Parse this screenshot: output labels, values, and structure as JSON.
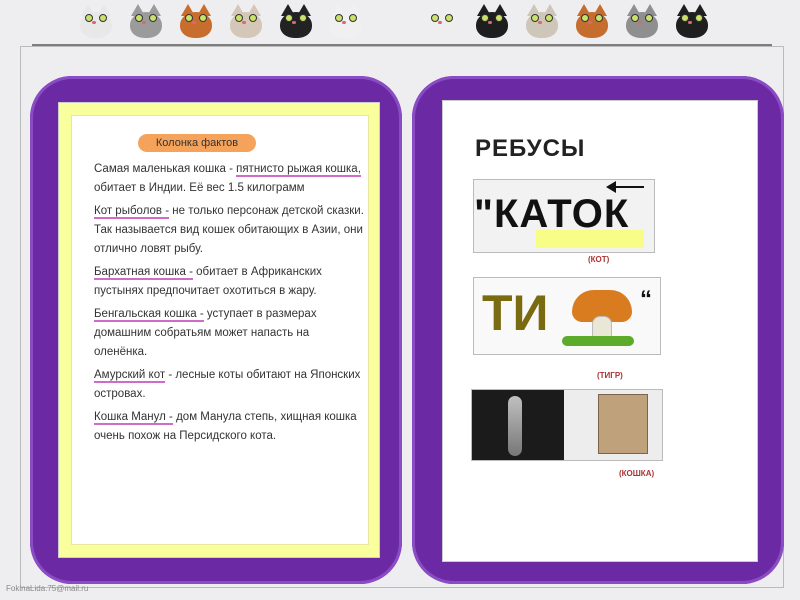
{
  "left_panel": {
    "title": "Колонка фактов",
    "facts": [
      {
        "lead": "",
        "hl": "пятнисто рыжая кошка,",
        "rest_before": "Самая маленькая кошка - ",
        "rest": " обитает в Индии. Её вес 1.5 килограмм"
      },
      {
        "hl": "Кот рыболов -",
        "rest": " не только персонаж детской сказки. Так называется вид кошек обитающих в Азии, они отлично ловят рыбу."
      },
      {
        "hl": "Бархатная кошка -",
        "rest": " обитает в Африканских пустынях предпочитает охотиться в жару."
      },
      {
        "hl": "Бенгальская кошка -",
        "rest": " уступает в размерах домашним собратьям может напасть на оленёнка."
      },
      {
        "hl": "Амурский кот",
        "rest": " - лесные коты обитают на Японских островах."
      },
      {
        "hl": "Кошка Манул -",
        "rest": " дом Манула степь, хищная кошка очень похож на Персидского кота."
      }
    ]
  },
  "right_panel": {
    "title": "РЕБУСЫ",
    "rebus1_text": "\"КАТОК",
    "rebus1_answer": "(КОТ)",
    "rebus2_text": "ТИ",
    "rebus2_mark": "“",
    "rebus2_answer": "(ТИГР)",
    "rebus3_answer": "(КОШКА)"
  },
  "colors": {
    "purple": "#6b2aa3",
    "highlight": "#d06cc8",
    "title_pill": "#f5a35a"
  },
  "footer": "FokinaLida.75@mail.ru"
}
